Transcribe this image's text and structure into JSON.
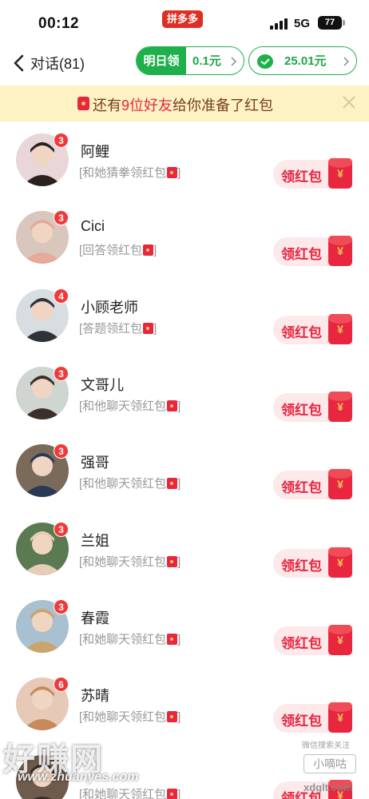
{
  "status_bar": {
    "time": "00:12",
    "app_badge": "拼多多",
    "network": "5G",
    "battery": "77"
  },
  "nav": {
    "title": "对话(81)",
    "tomorrow_label": "明日领",
    "tomorrow_value": "0.1元",
    "wallet_value": "25.01元"
  },
  "banner": {
    "prefix": "还有",
    "highlight": "9位好友",
    "suffix": "给你准备了红包"
  },
  "claim_label": "领红包",
  "currency_symbol": "¥",
  "contacts": [
    {
      "name": "阿鲤",
      "badge": "3",
      "sub": "[和她猜拳领红包",
      "sub_end": "]",
      "avatar_color": "#e9d6d9",
      "avatar_fg": "#2b2220"
    },
    {
      "name": "Cici",
      "badge": "3",
      "sub": "[回答领红包",
      "sub_end": "]",
      "avatar_color": "#d9c7bd",
      "avatar_fg": "#e6a99a"
    },
    {
      "name": "小顾老师",
      "badge": "4",
      "sub": "[答题领红包",
      "sub_end": "]",
      "avatar_color": "#d8dde2",
      "avatar_fg": "#2f3338"
    },
    {
      "name": "文哥儿",
      "badge": "3",
      "sub": "[和他聊天领红包",
      "sub_end": "]",
      "avatar_color": "#cfd5d0",
      "avatar_fg": "#3c2f2a"
    },
    {
      "name": "强哥",
      "badge": "3",
      "sub": "[和他聊天领红包",
      "sub_end": "]",
      "avatar_color": "#7a6a5a",
      "avatar_fg": "#2a3a55"
    },
    {
      "name": "兰姐",
      "badge": "3",
      "sub": "[和她聊天领红包",
      "sub_end": "]",
      "avatar_color": "#5a7a52",
      "avatar_fg": "#e7cdb8"
    },
    {
      "name": "春霞",
      "badge": "3",
      "sub": "[和她聊天领红包",
      "sub_end": "]",
      "avatar_color": "#a8c0cf",
      "avatar_fg": "#c9a46b"
    },
    {
      "name": "苏晴",
      "badge": "6",
      "sub": "[和她聊天领红包",
      "sub_end": "]",
      "avatar_color": "#e7c9b8",
      "avatar_fg": "#c88a5a"
    },
    {
      "name": "",
      "badge": "",
      "sub": "[和她聊天领红包",
      "sub_end": "]",
      "avatar_color": "#6e5b4c",
      "avatar_fg": "#3a2d25"
    }
  ],
  "watermark": {
    "left_text": "好赚网",
    "left_url": "www.zhuanyes.com",
    "right_top": "微信搜索关注",
    "right_mid": "小嘀咕",
    "right_url": "xdglt.com"
  },
  "colors": {
    "brand_red": "#e8263f",
    "green": "#1fb04b",
    "banner_bg": "#fdf2c4"
  }
}
